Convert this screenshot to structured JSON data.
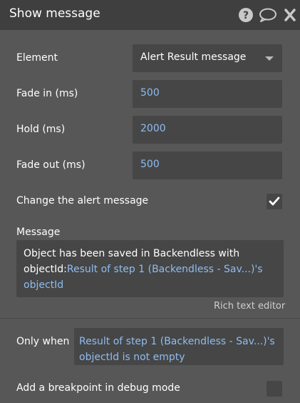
{
  "header": {
    "title": "Show message",
    "icons": [
      "help-icon",
      "comment-icon",
      "close-icon"
    ]
  },
  "fields": {
    "element_label": "Element",
    "element_value": "Alert Result message",
    "fade_in_label": "Fade in (ms)",
    "fade_in_value": "500",
    "hold_label": "Hold (ms)",
    "hold_value": "2000",
    "fade_out_label": "Fade out (ms)",
    "fade_out_value": "500",
    "change_alert_label": "Change the alert message",
    "change_alert_checked": true
  },
  "message": {
    "label": "Message",
    "text_static": "Object has been saved in Backendless with objectId:",
    "text_dynamic": "Result of step 1 (Backendless - Sav...)'s objectId",
    "editor_link": "Rich text editor"
  },
  "only_when": {
    "label": "Only when",
    "condition": "Result of step 1 (Backendless - Sav...)'s objectId is not empty"
  },
  "breakpoint": {
    "label": "Add a breakpoint in debug mode",
    "checked": false
  },
  "colors": {
    "background": "#575757",
    "header": "#3f3f3f",
    "field": "#464646",
    "dynamic_text": "#8ebcf0"
  }
}
